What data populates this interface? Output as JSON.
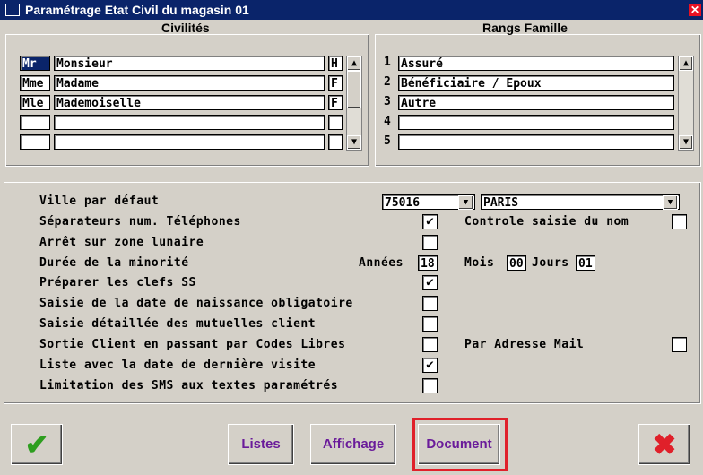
{
  "window": {
    "title": "Paramétrage Etat Civil du magasin 01"
  },
  "civilites": {
    "header": "Civilités",
    "rows": [
      {
        "code": "Mr",
        "label": "Monsieur",
        "gender": "H"
      },
      {
        "code": "Mme",
        "label": "Madame",
        "gender": "F"
      },
      {
        "code": "Mle",
        "label": "Mademoiselle",
        "gender": "F"
      },
      {
        "code": "",
        "label": "",
        "gender": ""
      },
      {
        "code": "",
        "label": "",
        "gender": ""
      }
    ]
  },
  "rangs": {
    "header": "Rangs Famille",
    "rows": [
      {
        "num": "1",
        "label": "Assuré"
      },
      {
        "num": "2",
        "label": "Bénéficiaire / Epoux"
      },
      {
        "num": "3",
        "label": "Autre"
      },
      {
        "num": "4",
        "label": ""
      },
      {
        "num": "5",
        "label": ""
      }
    ]
  },
  "settings": {
    "ville_label": "Ville par défaut",
    "ville_code": "75016",
    "ville_name": "PARIS",
    "separateurs_label": "Séparateurs num. Téléphones",
    "separateurs_checked": true,
    "controle_label": "Controle saisie du nom",
    "controle_checked": false,
    "arret_label": "Arrêt sur zone lunaire",
    "arret_checked": false,
    "minorite_label": "Durée de la minorité",
    "annees_label": "Années",
    "annees_value": "18",
    "mois_label": "Mois",
    "mois_value": "00",
    "jours_label": "Jours",
    "jours_value": "01",
    "clefs_label": "Préparer les clefs SS",
    "clefs_checked": true,
    "naissance_label": "Saisie de la date de naissance obligatoire",
    "naissance_checked": false,
    "mutuelles_label": "Saisie détaillée des mutuelles client",
    "mutuelles_checked": false,
    "sortie_label": "Sortie Client en passant par Codes Libres",
    "sortie_checked": false,
    "mail_label": "Par Adresse Mail",
    "mail_checked": false,
    "liste_label": "Liste avec la date de dernière visite",
    "liste_checked": true,
    "sms_label": "Limitation des SMS aux textes paramétrés",
    "sms_checked": false
  },
  "buttons": {
    "listes": "Listes",
    "affichage": "Affichage",
    "document": "Document"
  },
  "icons": {
    "validate": "check-icon",
    "cancel": "cross-icon",
    "check_glyph": "✔",
    "cross_glyph": "✖",
    "down_glyph": "▼",
    "up_glyph": "▲"
  },
  "colors": {
    "accent_purple": "#6a1b9a",
    "check_green": "#2e9e1f",
    "cancel_red": "#e0202a",
    "highlight_red": "#e0202a"
  }
}
